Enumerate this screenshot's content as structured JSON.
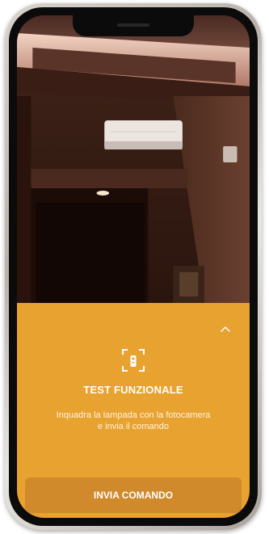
{
  "panel": {
    "title": "TEST FUNZIONALE",
    "description_line1": "Inquadra la lampada con la fotocamera",
    "description_line2": "e invia il comando",
    "button_label": "INVIA COMANDO",
    "accent_color": "#e8a230",
    "button_color": "#d08a2b",
    "icons": {
      "collapse": "chevron-up-icon",
      "scan": "remote-scan-icon"
    }
  },
  "camera_view": {
    "scene": "room-ceiling-with-air-conditioner"
  }
}
